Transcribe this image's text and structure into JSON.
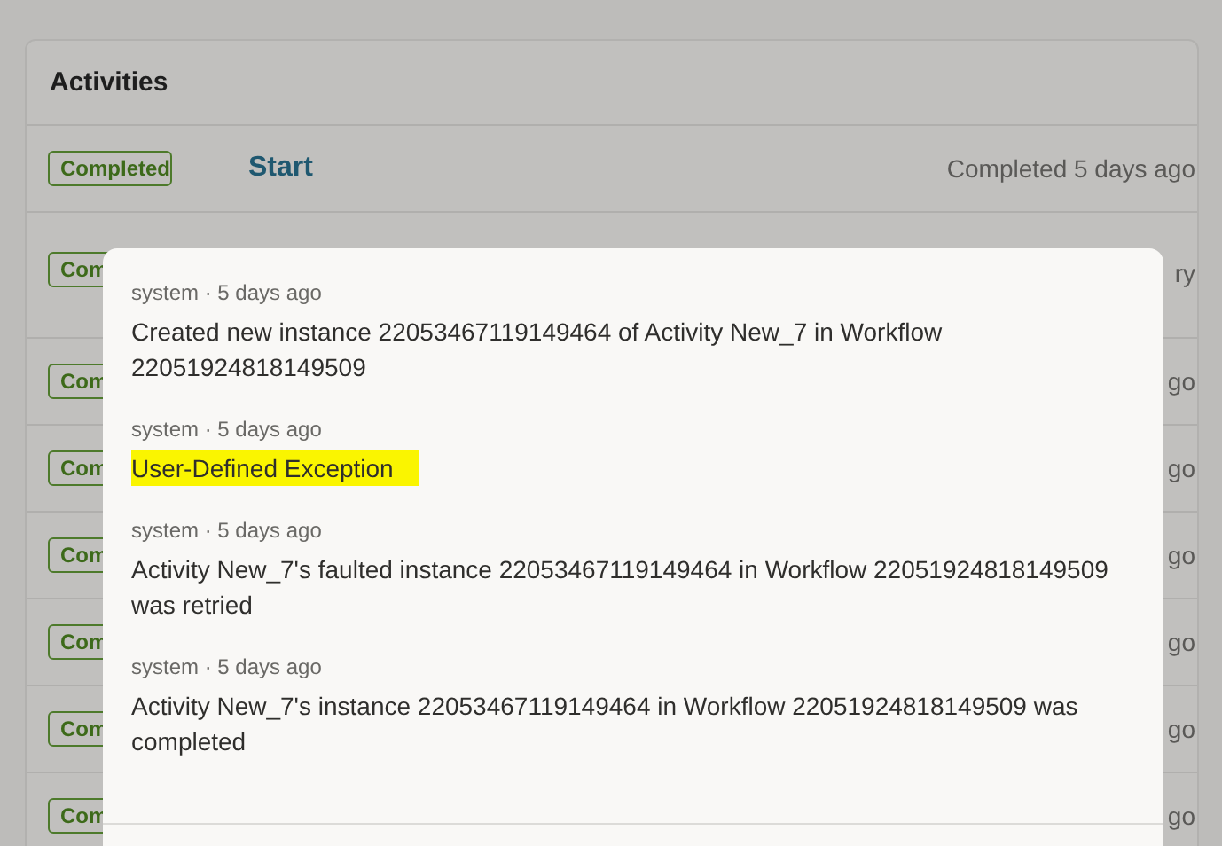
{
  "activities": {
    "title": "Activities",
    "rows": [
      {
        "badge": "Completed",
        "title": "Start",
        "status": "Completed 5 days ago"
      },
      {
        "badge": "Com",
        "status": "ry"
      },
      {
        "badge": "Com",
        "status": "go"
      },
      {
        "badge": "Com",
        "status": "go"
      },
      {
        "badge": "Com",
        "status": "go"
      },
      {
        "badge": "Com",
        "status": "go"
      },
      {
        "badge": "Com",
        "status": "go"
      },
      {
        "badge": "Com",
        "status": "go"
      }
    ]
  },
  "history": {
    "entries": [
      {
        "meta": "system · 5 days ago",
        "message": "Created new instance 22053467119149464 of Activity New_7 in Workflow 22051924818149509",
        "highlighted": false
      },
      {
        "meta": "system · 5 days ago",
        "message": "User-Defined Exception",
        "highlighted": true
      },
      {
        "meta": "system · 5 days ago",
        "message": "Activity New_7's faulted instance 22053467119149464 in Workflow 22051924818149509 was retried",
        "highlighted": false
      },
      {
        "meta": "system · 5 days ago",
        "message": "Activity New_7's instance 22053467119149464 in Workflow 22051924818149509 was completed",
        "highlighted": false
      }
    ]
  }
}
